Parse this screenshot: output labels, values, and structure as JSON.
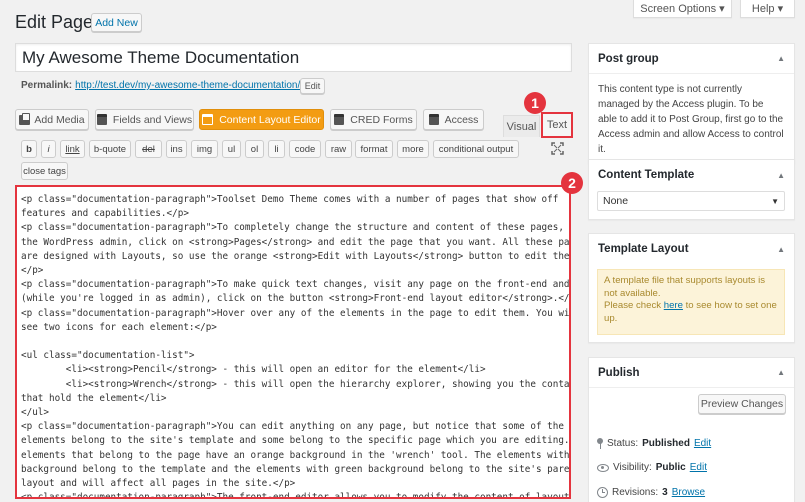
{
  "header": {
    "title": "Edit Page",
    "add_new": "Add New",
    "screen_options": "Screen Options ▾",
    "help": "Help ▾"
  },
  "post": {
    "title_value": "My Awesome Theme Documentation",
    "permalink_label": "Permalink:",
    "permalink_url": "http://test.dev/my-awesome-theme-documentation/",
    "edit_label": "Edit"
  },
  "media_buttons": {
    "add_media": "Add Media",
    "fields_views": "Fields and Views",
    "content_layout_editor": "Content Layout Editor",
    "cred_forms": "CRED Forms",
    "access": "Access"
  },
  "editor_tabs": {
    "visual": "Visual",
    "text": "Text"
  },
  "quicktags": [
    "b",
    "i",
    "link",
    "b-quote",
    "del",
    "ins",
    "img",
    "ul",
    "ol",
    "li",
    "code",
    "raw",
    "format",
    "more",
    "conditional output",
    "close tags"
  ],
  "annotations": {
    "badge_1": "1",
    "badge_2": "2"
  },
  "code_lines": [
    "<p class=\"documentation-paragraph\">Toolset Demo Theme comes with a number of pages that show off",
    "features and capabilities.</p>",
    "<p class=\"documentation-paragraph\">To completely change the structure and content of these pages, go to",
    "the WordPress admin, click on <strong>Pages</strong> and edit the page that you want. All these pages",
    "are designed with Layouts, so use the orange <strong>Edit with Layouts</strong> button to edit them.",
    "</p>",
    "<p class=\"documentation-paragraph\">To make quick text changes, visit any page on the front-end and",
    "(while you're logged in as admin), click on the button <strong>Front-end layout editor</strong>.</p>",
    "<p class=\"documentation-paragraph\">Hover over any of the elements in the page to edit them. You will",
    "see two icons for each element:</p>",
    "",
    "<ul class=\"documentation-list\">",
    "        <li><strong>Pencil</strong> - this will open an editor for the element</li>",
    "        <li><strong>Wrench</strong> - this will open the hierarchy explorer, showing you the containers",
    "that hold the element</li>",
    "</ul>",
    "<p class=\"documentation-paragraph\">You can edit anything on any page, but notice that some of the",
    "elements belong to the site's template and some belong to the specific page which you are editing. The",
    "elements that belong to the page have an orange background in the 'wrench' tool. The elements with gray",
    "background belong to the template and the elements with green background belong to the site's parent",
    "layout and will affect all pages in the site.</p>",
    "<p class=\"documentation-paragraph\">The front-end editor allows you to modify the content of layouts. In"
  ],
  "sidebar": {
    "post_group": {
      "title": "Post group",
      "text": "This content type is not currently managed by the Access plugin. To be able to add it to Post Group, first go to the Access admin and allow Access to control it."
    },
    "content_template": {
      "title": "Content Template",
      "selected": "None"
    },
    "template_layout": {
      "title": "Template Layout",
      "notice_1": "A template file that supports layouts is not available.",
      "notice_2_pre": "Please check ",
      "notice_2_link": "here",
      "notice_2_post": " to see how to set one up."
    },
    "publish": {
      "title": "Publish",
      "preview_changes": "Preview Changes",
      "status_label": "Status:",
      "status_value": "Published",
      "visibility_label": "Visibility:",
      "visibility_value": "Public",
      "revisions_label": "Revisions:",
      "revisions_value": "3",
      "edit": "Edit",
      "browse": "Browse"
    }
  },
  "colors": {
    "accent_orange": "#f39c12",
    "annotation_red": "#e4343e",
    "link_blue": "#0073aa",
    "notice_bg": "#fcf3d9"
  }
}
